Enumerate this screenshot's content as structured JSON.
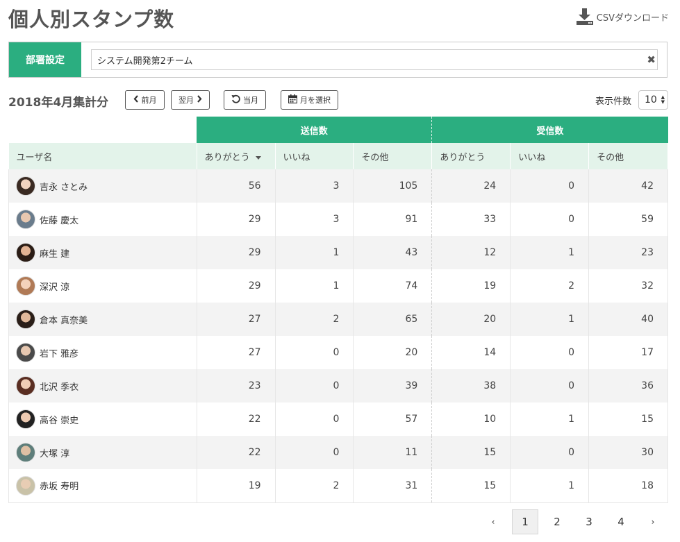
{
  "header": {
    "title": "個人別スタンプ数",
    "csv_label": "CSVダウンロード",
    "csv_icon": "download-icon"
  },
  "department": {
    "label": "部署設定",
    "value": "システム開発第2チーム",
    "clear_icon": "close-icon",
    "clear_glyph": "✖"
  },
  "toolbar": {
    "period": "2018年4月集計分",
    "prev_label": "前月",
    "next_label": "翌月",
    "current_label": "当月",
    "pick_label": "月を選択",
    "count_label": "表示件数",
    "count_value": "10"
  },
  "table": {
    "group_sent": "送信数",
    "group_received": "受信数",
    "columns": [
      "ユーザ名",
      "ありがとう",
      "いいね",
      "その他",
      "ありがとう",
      "いいね",
      "その他"
    ],
    "sorted_column": "sent_thanks",
    "rows": [
      {
        "name": "吉永 さとみ",
        "sent": [
          "56",
          "3",
          "105"
        ],
        "recv": [
          "24",
          "0",
          "42"
        ],
        "avatar": {
          "face": "#f2d3bf",
          "hair": "#3a2a22"
        }
      },
      {
        "name": "佐藤 慶太",
        "sent": [
          "29",
          "3",
          "91"
        ],
        "recv": [
          "33",
          "0",
          "59"
        ],
        "avatar": {
          "face": "#e8c8b0",
          "hair": "#6a7c8c"
        }
      },
      {
        "name": "麻生 建",
        "sent": [
          "29",
          "1",
          "43"
        ],
        "recv": [
          "12",
          "1",
          "23"
        ],
        "avatar": {
          "face": "#e2b394",
          "hair": "#2b1d16"
        }
      },
      {
        "name": "深沢 涼",
        "sent": [
          "29",
          "1",
          "74"
        ],
        "recv": [
          "19",
          "2",
          "32"
        ],
        "avatar": {
          "face": "#f4d2bc",
          "hair": "#b07a56"
        }
      },
      {
        "name": "倉本 真奈美",
        "sent": [
          "27",
          "2",
          "65"
        ],
        "recv": [
          "20",
          "1",
          "40"
        ],
        "avatar": {
          "face": "#e0b89a",
          "hair": "#2a1e18"
        }
      },
      {
        "name": "岩下 雅彦",
        "sent": [
          "27",
          "0",
          "20"
        ],
        "recv": [
          "14",
          "0",
          "17"
        ],
        "avatar": {
          "face": "#e6c7b0",
          "hair": "#4a4a4a"
        }
      },
      {
        "name": "北沢 季衣",
        "sent": [
          "23",
          "0",
          "39"
        ],
        "recv": [
          "38",
          "0",
          "36"
        ],
        "avatar": {
          "face": "#f0cdb6",
          "hair": "#5a2e22"
        }
      },
      {
        "name": "高谷 崇史",
        "sent": [
          "22",
          "0",
          "57"
        ],
        "recv": [
          "10",
          "1",
          "15"
        ],
        "avatar": {
          "face": "#eccab2",
          "hair": "#222222"
        }
      },
      {
        "name": "大塚 淳",
        "sent": [
          "22",
          "0",
          "11"
        ],
        "recv": [
          "15",
          "0",
          "30"
        ],
        "avatar": {
          "face": "#dfc0a4",
          "hair": "#5e7e7a"
        }
      },
      {
        "name": "赤坂 寿明",
        "sent": [
          "19",
          "2",
          "31"
        ],
        "recv": [
          "15",
          "1",
          "18"
        ],
        "avatar": {
          "face": "#e8cdb4",
          "hair": "#c9c2a8"
        }
      }
    ]
  },
  "pagination": {
    "prev": "‹",
    "next": "›",
    "pages": [
      "1",
      "2",
      "3",
      "4"
    ],
    "current": "1"
  },
  "colors": {
    "accent": "#2bae80",
    "header_row": "#e3f3ea",
    "stripe": "#f3f3f3"
  }
}
